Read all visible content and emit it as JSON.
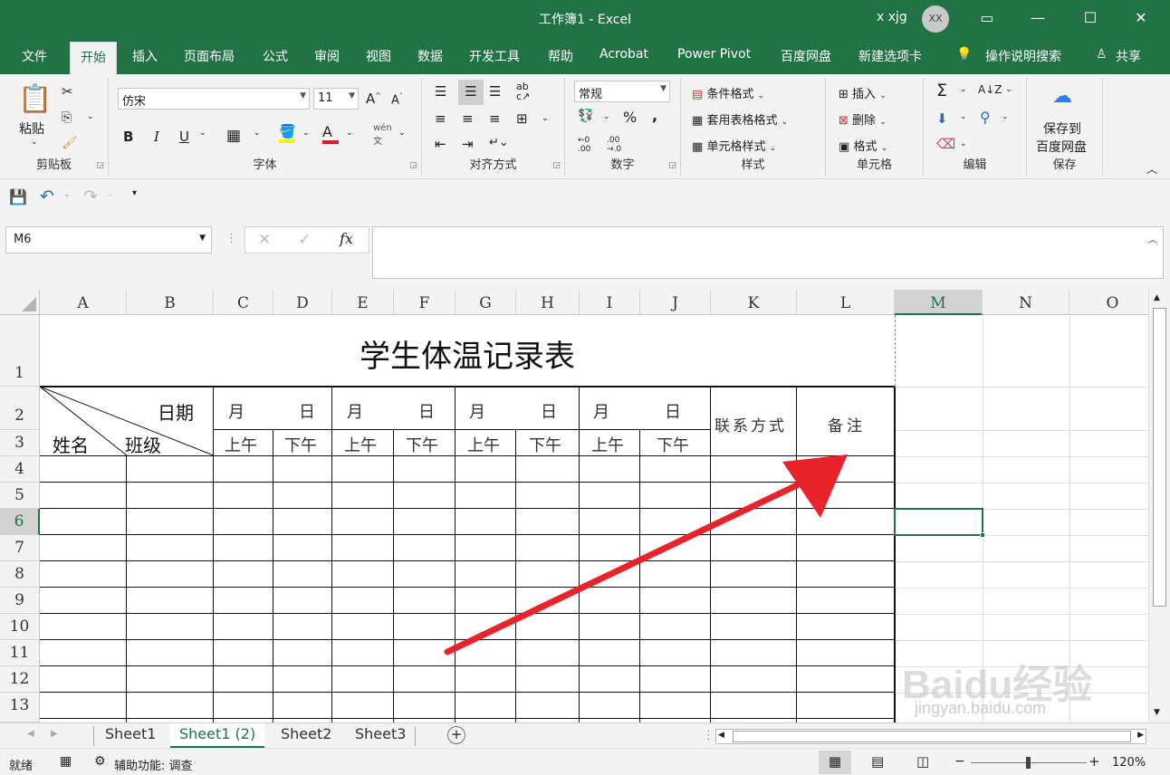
{
  "window": {
    "title": "工作簿1  -  Excel",
    "user": "x xjg",
    "avatar_initials": "XX"
  },
  "tabs": [
    "文件",
    "开始",
    "插入",
    "页面布局",
    "公式",
    "审阅",
    "视图",
    "数据",
    "开发工具",
    "帮助",
    "Acrobat",
    "Power Pivot",
    "百度网盘",
    "新建选项卡"
  ],
  "active_tab": "开始",
  "tell_me": "操作说明搜索",
  "share": "共享",
  "ribbon": {
    "clipboard": {
      "label": "剪贴板",
      "paste": "粘贴"
    },
    "font": {
      "label": "字体",
      "font_name": "仿宋",
      "font_size": "11",
      "bold": "B",
      "italic": "I",
      "underline": "U",
      "wen": "wén"
    },
    "alignment": {
      "label": "对齐方式"
    },
    "number": {
      "label": "数字",
      "format": "常规"
    },
    "styles": {
      "label": "样式",
      "conditional": "条件格式",
      "table": "套用表格格式",
      "cell_styles": "单元格样式"
    },
    "cells": {
      "label": "单元格",
      "insert": "插入",
      "delete": "删除",
      "format": "格式"
    },
    "editing": {
      "label": "编辑"
    },
    "save": {
      "label": "保存",
      "button_line1": "保存到",
      "button_line2": "百度网盘"
    }
  },
  "name_box": "M6",
  "formula": "",
  "columns": [
    "A",
    "B",
    "C",
    "D",
    "E",
    "F",
    "G",
    "H",
    "I",
    "J",
    "K",
    "L",
    "M",
    "N",
    "O"
  ],
  "selected_column": "M",
  "rows": [
    "1",
    "2",
    "3",
    "4",
    "5",
    "6",
    "7",
    "8",
    "9",
    "10",
    "11",
    "12",
    "13"
  ],
  "selected_row": "6",
  "table": {
    "title": "学生体温记录表",
    "date_label": "日期",
    "name_label": "姓名",
    "class_label": "班级",
    "month": "月",
    "day": "日",
    "am": "上午",
    "pm": "下午",
    "contact": "联系方式",
    "remark": "备注"
  },
  "sheets": [
    "Sheet1",
    "Sheet1 (2)",
    "Sheet2",
    "Sheet3"
  ],
  "active_sheet": "Sheet1 (2)",
  "status": {
    "ready": "就绪",
    "accessibility": "辅助功能: 调查",
    "zoom": "120%"
  },
  "watermark": {
    "brand": "Baidu经验",
    "url": "jingyan.baidu.com"
  },
  "colors": {
    "excel_green": "#217346",
    "arrow_red": "#e8232b"
  }
}
